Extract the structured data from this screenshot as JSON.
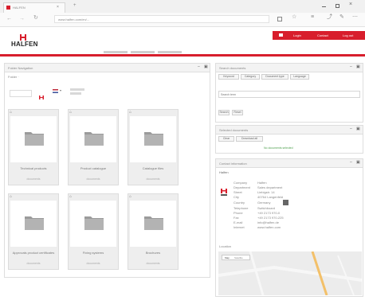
{
  "browser": {
    "tab_title": "HALFEN",
    "url": "www.halfen.com/en/...",
    "window_controls": [
      "minimize-icon",
      "maximize-icon",
      "close-icon"
    ]
  },
  "header": {
    "logo_text": "HALFEN",
    "top_links": [
      "Login",
      "Contact",
      "Log out"
    ],
    "colors": {
      "brand_red": "#d81e2c"
    }
  },
  "left_panel": {
    "title": "Folder Navigation",
    "path_label": "Folder ·",
    "folders": [
      {
        "name": "Technical products",
        "sub": "documents"
      },
      {
        "name": "Product catalogue",
        "sub": "documents"
      },
      {
        "name": "Catalogue files",
        "sub": "documents"
      },
      {
        "name": "Approvals product certificates",
        "sub": "documents"
      },
      {
        "name": "Fixing systems",
        "sub": "documents"
      },
      {
        "name": "Brochures",
        "sub": "documents"
      }
    ]
  },
  "search_panel": {
    "title": "Search documents",
    "tabs": [
      "Keyword",
      "Category",
      "Document type",
      "Language"
    ],
    "input_placeholder": "Search term",
    "search_button": "Search",
    "reset_button": "Reset"
  },
  "basket_panel": {
    "title": "Selected documents",
    "buttons": [
      "Clear",
      "Download all"
    ],
    "status_text": "No documents selected"
  },
  "contact_panel": {
    "title": "Contact information",
    "company": "Halfen",
    "rows": [
      {
        "label": "Company",
        "value": "Halfen"
      },
      {
        "label": "Department",
        "value": "Sales department"
      },
      {
        "label": "Street",
        "value": "Liebigstr. 14"
      },
      {
        "label": "City",
        "value": "40764 Langenfeld"
      },
      {
        "label": "Country",
        "value": "Germany"
      },
      {
        "label": "Telephone",
        "value": "Switchboard"
      },
      {
        "label": "Phone",
        "value": "+49 2173 970-0"
      },
      {
        "label": "Fax",
        "value": "+49 2173 970-225"
      },
      {
        "label": "E-mail",
        "value": "info@halfen.de"
      },
      {
        "label": "Internet",
        "value": "www.halfen.com"
      }
    ],
    "location_label": "Location",
    "map_tabs": [
      "Map",
      "Satellite"
    ]
  }
}
